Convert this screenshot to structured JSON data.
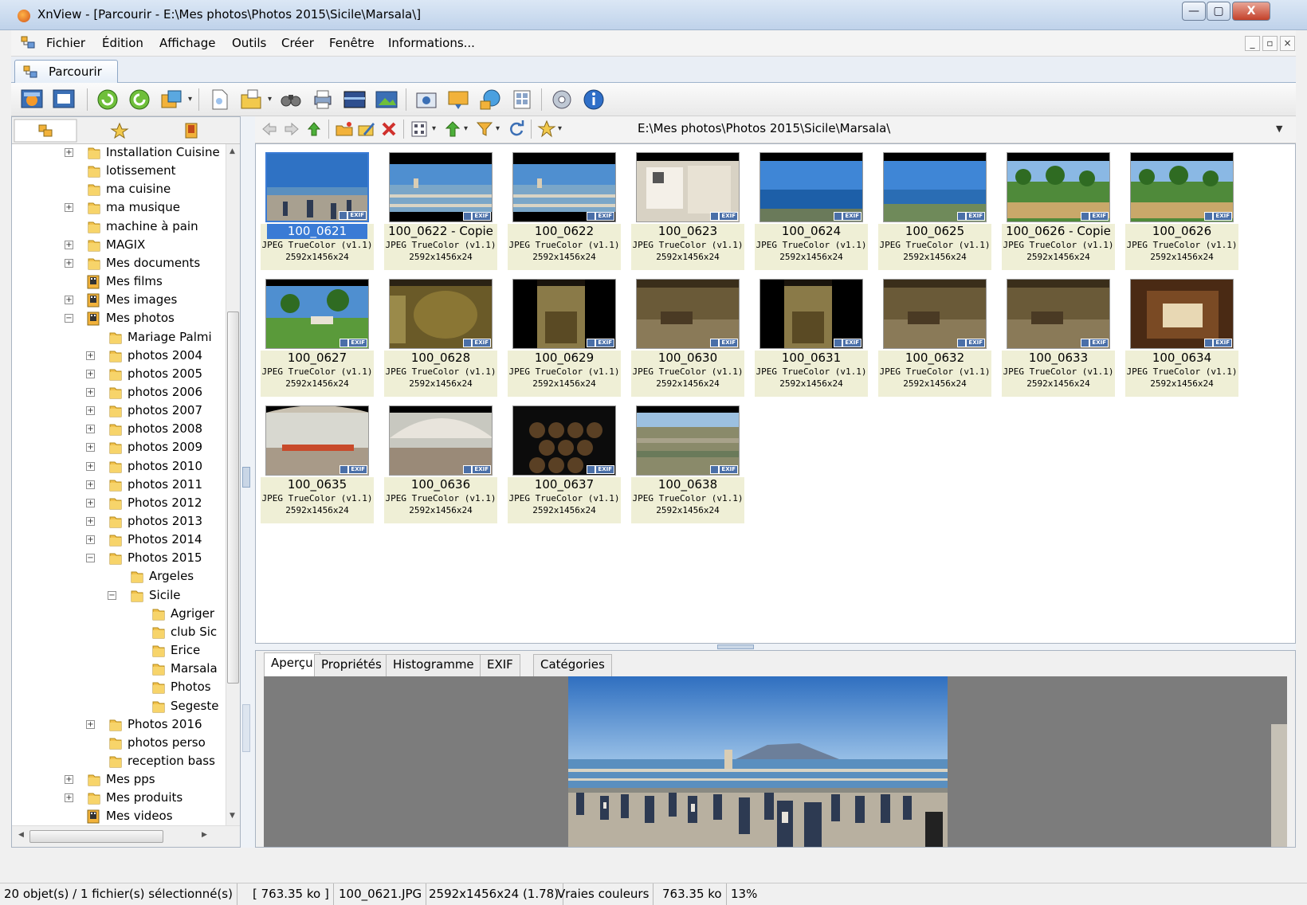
{
  "window": {
    "title": "XnView - [Parcourir - E:\\Mes photos\\Photos 2015\\Sicile\\Marsala\\]",
    "min_glyph": "—",
    "max_glyph": "▢",
    "close_glyph": "X"
  },
  "menubar": {
    "items": [
      "Fichier",
      "Édition",
      "Affichage",
      "Outils",
      "Créer",
      "Fenêtre",
      "Informations..."
    ]
  },
  "tabs": {
    "browse_label": "Parcourir"
  },
  "nav": {
    "address": "E:\\Mes photos\\Photos 2015\\Sicile\\Marsala\\"
  },
  "tree": {
    "items": [
      {
        "label": "Installation Cuisine"
      },
      {
        "label": "lotissement"
      },
      {
        "label": "ma cuisine"
      },
      {
        "label": "ma musique"
      },
      {
        "label": "machine à pain"
      },
      {
        "label": "MAGIX"
      },
      {
        "label": "Mes documents"
      },
      {
        "label": "Mes films"
      },
      {
        "label": "Mes images"
      },
      {
        "label": "Mes photos"
      },
      {
        "label": "Mariage Palmi"
      },
      {
        "label": "photos 2004"
      },
      {
        "label": "photos 2005"
      },
      {
        "label": "photos 2006"
      },
      {
        "label": "photos 2007"
      },
      {
        "label": "photos 2008"
      },
      {
        "label": "photos 2009"
      },
      {
        "label": "photos 2010"
      },
      {
        "label": "photos 2011"
      },
      {
        "label": "Photos 2012"
      },
      {
        "label": "photos 2013"
      },
      {
        "label": "Photos 2014"
      },
      {
        "label": "Photos 2015"
      },
      {
        "label": "Argeles"
      },
      {
        "label": "Sicile"
      },
      {
        "label": "Agriger"
      },
      {
        "label": "club Sic"
      },
      {
        "label": "Erice"
      },
      {
        "label": "Marsala"
      },
      {
        "label": "Photos"
      },
      {
        "label": "Segeste"
      },
      {
        "label": "Photos 2016"
      },
      {
        "label": "photos perso"
      },
      {
        "label": "reception bass"
      },
      {
        "label": "Mes pps"
      },
      {
        "label": "Mes produits"
      },
      {
        "label": "Mes videos"
      }
    ]
  },
  "thumbnails": [
    {
      "name": "100_0621",
      "type": "JPEG TrueColor (v1.1)",
      "dims": "2592x1456x24",
      "selected": true
    },
    {
      "name": "100_0622 - Copie",
      "type": "JPEG TrueColor (v1.1)",
      "dims": "2592x1456x24"
    },
    {
      "name": "100_0622",
      "type": "JPEG TrueColor (v1.1)",
      "dims": "2592x1456x24"
    },
    {
      "name": "100_0623",
      "type": "JPEG TrueColor (v1.1)",
      "dims": "2592x1456x24"
    },
    {
      "name": "100_0624",
      "type": "JPEG TrueColor (v1.1)",
      "dims": "2592x1456x24"
    },
    {
      "name": "100_0625",
      "type": "JPEG TrueColor (v1.1)",
      "dims": "2592x1456x24"
    },
    {
      "name": "100_0626 - Copie",
      "type": "JPEG TrueColor (v1.1)",
      "dims": "2592x1456x24"
    },
    {
      "name": "100_0626",
      "type": "JPEG TrueColor (v1.1)",
      "dims": "2592x1456x24"
    },
    {
      "name": "100_0627",
      "type": "JPEG TrueColor (v1.1)",
      "dims": "2592x1456x24"
    },
    {
      "name": "100_0628",
      "type": "JPEG TrueColor (v1.1)",
      "dims": "2592x1456x24"
    },
    {
      "name": "100_0629",
      "type": "JPEG TrueColor (v1.1)",
      "dims": "2592x1456x24"
    },
    {
      "name": "100_0630",
      "type": "JPEG TrueColor (v1.1)",
      "dims": "2592x1456x24"
    },
    {
      "name": "100_0631",
      "type": "JPEG TrueColor (v1.1)",
      "dims": "2592x1456x24"
    },
    {
      "name": "100_0632",
      "type": "JPEG TrueColor (v1.1)",
      "dims": "2592x1456x24"
    },
    {
      "name": "100_0633",
      "type": "JPEG TrueColor (v1.1)",
      "dims": "2592x1456x24"
    },
    {
      "name": "100_0634",
      "type": "JPEG TrueColor (v1.1)",
      "dims": "2592x1456x24"
    },
    {
      "name": "100_0635",
      "type": "JPEG TrueColor (v1.1)",
      "dims": "2592x1456x24"
    },
    {
      "name": "100_0636",
      "type": "JPEG TrueColor (v1.1)",
      "dims": "2592x1456x24"
    },
    {
      "name": "100_0637",
      "type": "JPEG TrueColor (v1.1)",
      "dims": "2592x1456x24"
    },
    {
      "name": "100_0638",
      "type": "JPEG TrueColor (v1.1)",
      "dims": "2592x1456x24"
    }
  ],
  "thumb_badge": "EXIF",
  "bottom_tabs": [
    "Aperçu",
    "Propriétés",
    "Histogramme",
    "EXIF",
    "Catégories"
  ],
  "statusbar": {
    "count": "20 objet(s) / 1 fichier(s) sélectionné(s)",
    "size": "[ 763.35 ko ]",
    "filename": "100_0621.JPG",
    "dims": "2592x1456x24 (1.78)",
    "colors": "Vraies couleurs",
    "filesize": "763.35 ko",
    "zoom": "13%"
  },
  "colors": {
    "selection": "#3a7bd5",
    "thumb_meta_bg": "#efefd6",
    "preview_bg": "#7c7c7c"
  }
}
